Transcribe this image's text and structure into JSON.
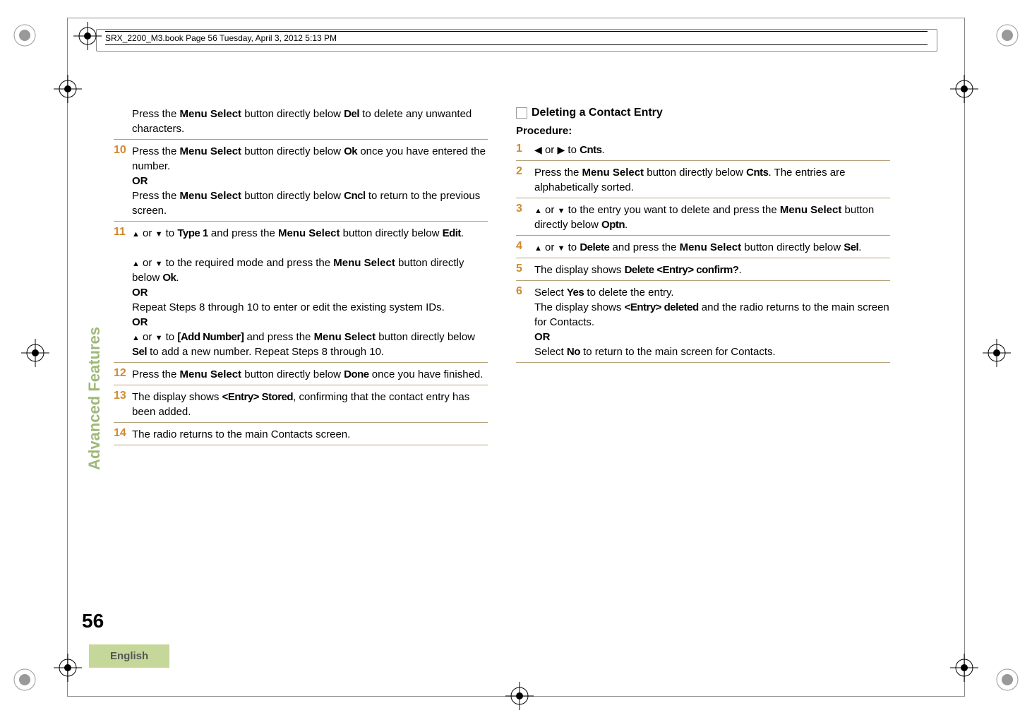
{
  "header": "SRX_2200_M3.book  Page 56  Tuesday, April 3, 2012  5:13 PM",
  "sidebar": "Advanced Features",
  "pageNumber": "56",
  "language": "English",
  "left": {
    "pre": {
      "t1": "Press the ",
      "t2": "Menu Select",
      "t3": " button directly below ",
      "t4": "Del",
      "t5": " to delete any unwanted characters."
    },
    "s10": {
      "n": "10",
      "t1": "Press the ",
      "t2": "Menu Select",
      "t3": " button directly below ",
      "t4": "Ok",
      "t5": " once you have entered the number.",
      "or": "OR",
      "t6": "Press the ",
      "t7": "Menu Select",
      "t8": " button directly below ",
      "t9": "Cncl",
      "t10": " to return to the previous screen."
    },
    "s11": {
      "n": "11",
      "a1": "U",
      "a2": " or ",
      "a3": "D",
      "a4": " to ",
      "t1": "Type 1",
      "t2": " and press the ",
      "t3": "Menu Select",
      "t4": " button directly below ",
      "t5": "Edit",
      "t6": ".",
      "b1": "U",
      "b2": " or ",
      "b3": "D",
      "b4": " to the required mode and press the ",
      "b5": "Menu Select",
      "b6": " button directly below ",
      "b7": "Ok",
      "b8": ".",
      "or1": "OR",
      "c1": "Repeat Steps 8 through 10 to enter or edit the existing system IDs.",
      "or2": "OR",
      "d1": "U",
      "d2": " or ",
      "d3": "D",
      "d4": " to ",
      "d5": "[Add Number]",
      "d6": " and press the ",
      "d7": "Menu Select",
      "d8": " button directly below ",
      "d9": "Sel",
      "d10": " to add a new number. Repeat Steps 8 through 10."
    },
    "s12": {
      "n": "12",
      "t1": "Press the ",
      "t2": "Menu Select",
      "t3": " button directly below ",
      "t4": "Done",
      "t5": " once you have finished."
    },
    "s13": {
      "n": "13",
      "t1": "The display shows ",
      "t2": "<Entry> Stored",
      "t3": ", confirming that the contact entry has been added."
    },
    "s14": {
      "n": "14",
      "t1": "The radio returns to the main Contacts screen."
    }
  },
  "right": {
    "title": "Deleting a Contact Entry",
    "proc": "Procedure:",
    "s1": {
      "n": "1",
      "a1": "<",
      "a2": " or ",
      "a3": ">",
      "a4": " to ",
      "t1": "Cnts",
      "t2": "."
    },
    "s2": {
      "n": "2",
      "t1": "Press the ",
      "t2": "Menu Select",
      "t3": " button directly below ",
      "t4": "Cnts",
      "t5": ". The entries are alphabetically sorted."
    },
    "s3": {
      "n": "3",
      "a1": "U",
      "a2": " or ",
      "a3": "D",
      "a4": " to the entry you want to delete and press the ",
      "t1": "Menu Select",
      "t2": " button directly below ",
      "t3": "Optn",
      "t4": "."
    },
    "s4": {
      "n": "4",
      "a1": "U",
      "a2": " or ",
      "a3": "D",
      "a4": " to ",
      "t1": "Delete",
      "t2": " and press the ",
      "t3": "Menu Select",
      "t4": " button directly below ",
      "t5": "Sel",
      "t6": "."
    },
    "s5": {
      "n": "5",
      "t1": "The display shows ",
      "t2": "Delete <Entry> confirm?",
      "t3": "."
    },
    "s6": {
      "n": "6",
      "t1": "Select ",
      "t2": "Yes",
      "t3": " to delete the entry.",
      "t4": "The display shows ",
      "t5": "<Entry> deleted",
      "t6": " and the radio returns to the main screen for Contacts.",
      "or": "OR",
      "t7": "Select ",
      "t8": "No",
      "t9": " to return to the main screen for Contacts."
    }
  }
}
